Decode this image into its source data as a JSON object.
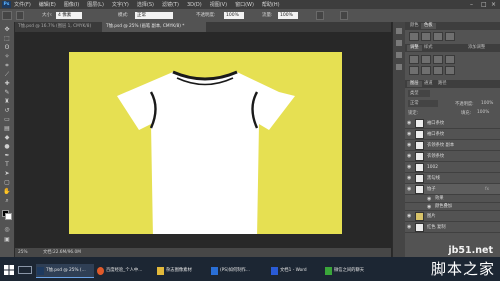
{
  "menubar": {
    "app_icon_label": "Ps",
    "items": [
      "文件(F)",
      "编辑(E)",
      "图像(I)",
      "图层(L)",
      "文字(Y)",
      "选择(S)",
      "滤镜(T)",
      "3D(D)",
      "视图(V)",
      "窗口(W)",
      "帮助(H)"
    ]
  },
  "options": {
    "size_label": "大小:",
    "size_value": "4 像素",
    "mode_label": "模式:",
    "mode_value": "正常",
    "opacity_label": "不透明度:",
    "opacity_value": "100%",
    "flow_label": "流量:",
    "flow_value": "100%"
  },
  "tabs": [
    {
      "label": "T恤.psd @ 16.7% (图层 1, CMYK/8)",
      "active": false
    },
    {
      "label": "T恤.psd @ 25% (画笔 副本, CMYK/8) *",
      "active": true
    }
  ],
  "status": {
    "zoom": "25%",
    "doc_info": "文档:22.6M/96.0M"
  },
  "panel": {
    "top_tabs": [
      "颜色",
      "色板"
    ],
    "mid_tabs": [
      "调整",
      "样式"
    ],
    "add_label": "添加调整",
    "layers_tabs": [
      "图层",
      "通道",
      "路径"
    ],
    "filter_label": "类型",
    "blend_mode": "正常",
    "opacity_label": "不透明度:",
    "opacity_value": "100%",
    "lock_label": "锁定:",
    "fill_label": "填充:",
    "fill_value": "100%",
    "layers": [
      {
        "name": "袖口条纹",
        "kind": "normal"
      },
      {
        "name": "袖口条纹",
        "kind": "normal"
      },
      {
        "name": "衣领条纹 副本",
        "kind": "normal"
      },
      {
        "name": "衣领条纹",
        "kind": "normal"
      },
      {
        "name": "1002",
        "kind": "normal"
      },
      {
        "name": "黑勾线",
        "kind": "normal"
      },
      {
        "name": "恤子",
        "kind": "normal",
        "fx": "fx"
      },
      {
        "name": "效果",
        "kind": "sub"
      },
      {
        "name": "颜色叠加",
        "kind": "sub"
      },
      {
        "name": "图片",
        "kind": "group"
      },
      {
        "name": "红色 复制",
        "kind": "normal"
      }
    ]
  },
  "taskbar": {
    "items": [
      {
        "label": "T恤.psd @ 25% (...",
        "color": "#1e3a5f",
        "active": true
      },
      {
        "label": "百度经验_个人中...",
        "color": "#e05a2a",
        "active": false
      },
      {
        "label": "杂志图像素材",
        "color": "#e2b93b",
        "active": false
      },
      {
        "label": "(PS)如何制作...",
        "color": "#2a6fd6",
        "active": false
      },
      {
        "label": "文档1 - Word",
        "color": "#2a5bd6",
        "active": false
      },
      {
        "label": "微信之间的聊天",
        "color": "#3aa63a",
        "active": false
      }
    ]
  },
  "watermark": {
    "domain": "jb51.net",
    "name": "脚本之家"
  },
  "colors": {
    "artboard": "#e6e052",
    "shirt": "#ffffff",
    "outline": "#1a1a1a",
    "foreground": "#000000",
    "background": "#ffffff"
  }
}
